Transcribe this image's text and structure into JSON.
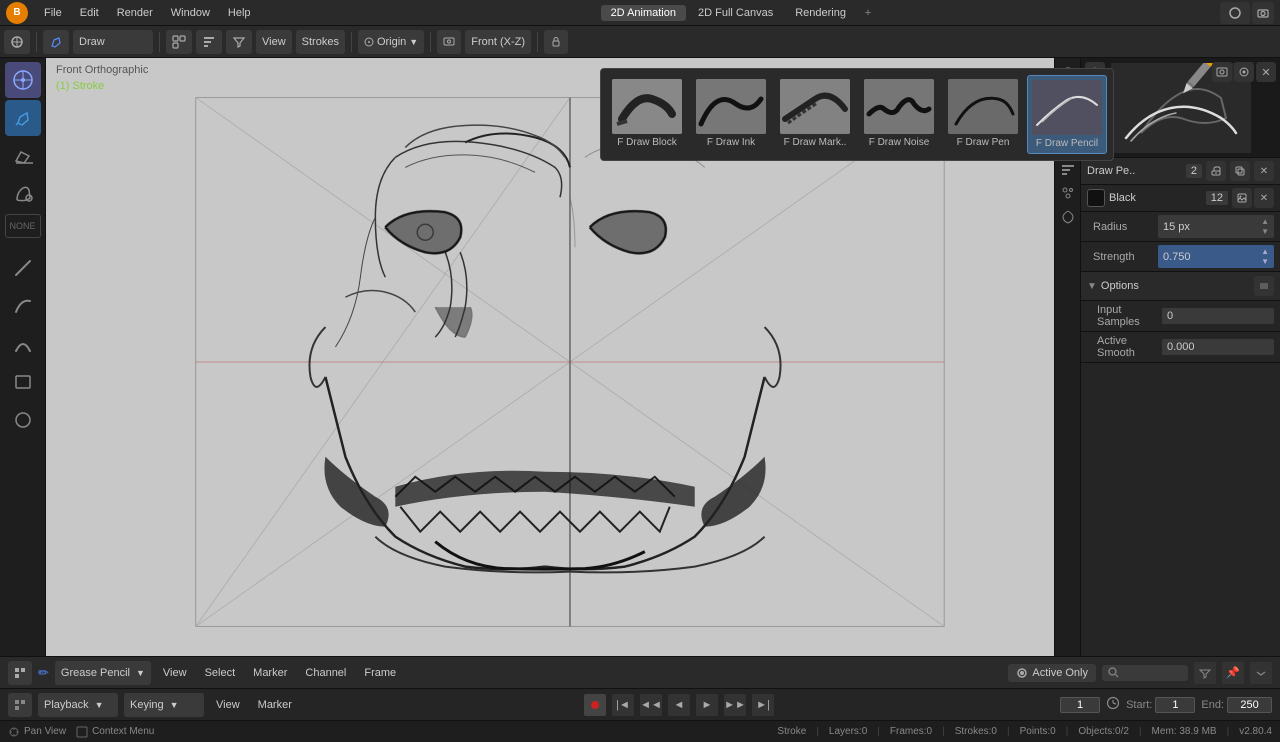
{
  "app": {
    "logo": "B",
    "menus": [
      "File",
      "Edit",
      "Render",
      "Window",
      "Help"
    ],
    "workspaces": [
      "2D Animation",
      "2D Full Canvas",
      "Rendering"
    ],
    "plus": "+"
  },
  "toolbar2": {
    "mode": "Draw",
    "view_btn": "View",
    "strokes_btn": "Strokes",
    "origin_btn": "Origin",
    "front_xz_btn": "Front (X-Z)"
  },
  "brushes": [
    {
      "id": "draw_block",
      "name": "F Draw Block",
      "active": false
    },
    {
      "id": "draw_ink",
      "name": "F Draw Ink",
      "active": false
    },
    {
      "id": "draw_mark",
      "name": "F Draw Mark..",
      "active": false
    },
    {
      "id": "draw_noise",
      "name": "F Draw Noise",
      "active": false
    },
    {
      "id": "draw_pen",
      "name": "F Draw Pen",
      "active": false
    },
    {
      "id": "draw_pencil",
      "name": "F Draw Pencil",
      "active": true
    }
  ],
  "viewport": {
    "label": "Front Orthographic",
    "stroke_label": "(1) Stroke"
  },
  "right_panel": {
    "brush_name": "Draw Pe..",
    "brush_number": "2",
    "color_name": "Black",
    "color_value": "12",
    "radius_label": "Radius",
    "radius_value": "15 px",
    "strength_label": "Strength",
    "strength_value": "0.750",
    "options_label": "Options",
    "input_samples_label": "Input Samples",
    "input_samples_value": "0",
    "active_smooth_label": "Active Smooth",
    "active_smooth_value": "0.000"
  },
  "bottom1": {
    "mode": "Grease Pencil",
    "view": "View",
    "select": "Select",
    "marker": "Marker",
    "channel": "Channel",
    "frame": "Frame",
    "active_only": "Active Only"
  },
  "bottom2": {
    "playback": "Playback",
    "keying": "Keying",
    "view": "View",
    "marker": "Marker"
  },
  "timeline": {
    "current_frame": "1",
    "start_label": "Start:",
    "start_value": "1",
    "end_label": "End:",
    "end_value": "250"
  },
  "status_bar": {
    "mode": "Stroke",
    "layers": "Layers:0",
    "frames": "Frames:0",
    "strokes": "Strokes:0",
    "points": "Points:0",
    "objects": "Objects:0/2",
    "mem": "Mem: 38.9 MB",
    "version": "v2.80.4",
    "pan_view": "Pan View",
    "context_menu": "Context Menu"
  }
}
